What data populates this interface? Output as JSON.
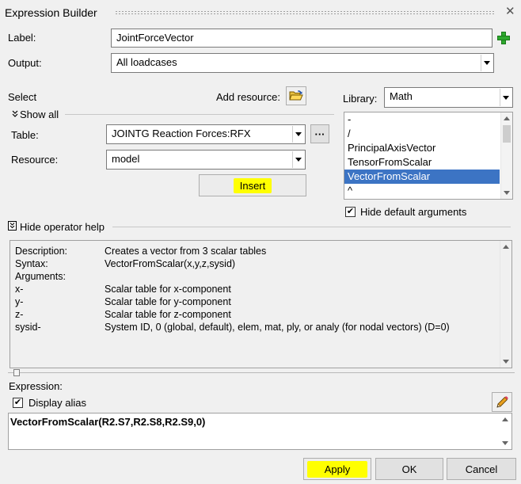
{
  "window": {
    "title": "Expression Builder",
    "close_glyph": "✕"
  },
  "label_row": {
    "label": "Label:",
    "value": "JointForceVector",
    "add_icon": "plus-icon"
  },
  "output_row": {
    "label": "Output:",
    "value": "All loadcases"
  },
  "select_section": {
    "title": "Select",
    "add_resource_label": "Add resource:",
    "add_resource_icon": "open-folder-icon",
    "show_all_label": "Show all",
    "table_label": "Table:",
    "table_value": "JOINTG Reaction Forces:RFX",
    "table_more_label": "···",
    "resource_label": "Resource:",
    "resource_value": "model",
    "insert_label": "Insert"
  },
  "library": {
    "label": "Library:",
    "value": "Math",
    "items": [
      "-",
      "/",
      "PrincipalAxisVector",
      "TensorFromScalar",
      "VectorFromScalar",
      "^"
    ],
    "selected": "VectorFromScalar",
    "hide_default_args_label": "Hide default arguments",
    "hide_default_args_checked": true
  },
  "operator_help": {
    "toggle_label": "Hide operator help",
    "rows": [
      {
        "key": "Description:",
        "value": "Creates a vector from 3 scalar tables"
      },
      {
        "key": "Syntax:",
        "value": "VectorFromScalar(x,y,z,sysid)"
      },
      {
        "key": "Arguments:",
        "value": ""
      },
      {
        "key": "x-",
        "value": "Scalar table for x-component"
      },
      {
        "key": "y-",
        "value": "Scalar table for y-component"
      },
      {
        "key": "z-",
        "value": "Scalar table for z-component"
      },
      {
        "key": "sysid-",
        "value": "System ID, 0 (global, default), elem, mat, ply, or analy (for nodal vectors) (D=0)"
      }
    ]
  },
  "expression": {
    "label": "Expression:",
    "display_alias_label": "Display alias",
    "display_alias_checked": true,
    "edit_icon": "pencil-icon",
    "value": "VectorFromScalar(R2.S7,R2.S8,R2.S9,0)"
  },
  "buttons": {
    "apply": "Apply",
    "ok": "OK",
    "cancel": "Cancel"
  },
  "colors": {
    "highlight": "#ffff00",
    "selection": "#3c74c4",
    "plus_green": "#2ea82e"
  }
}
